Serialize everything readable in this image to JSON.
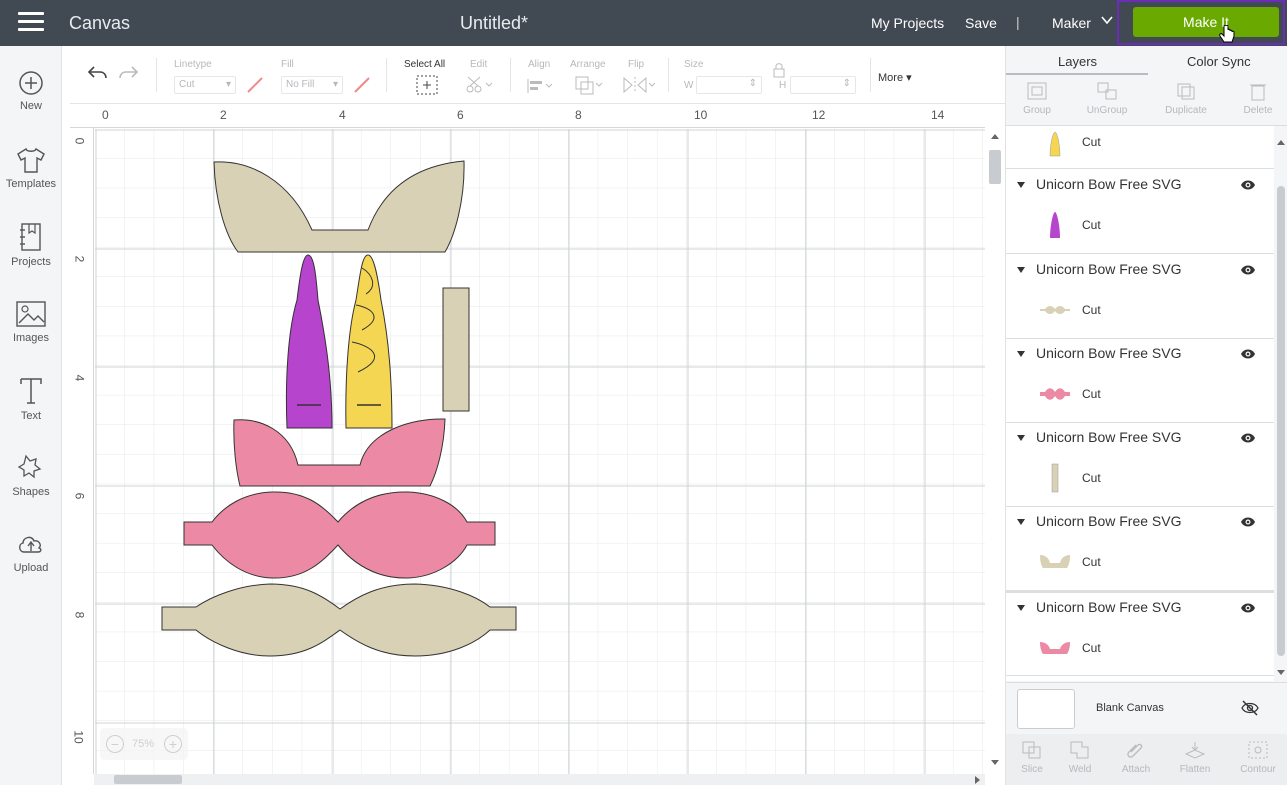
{
  "topbar": {
    "app_title": "Canvas",
    "doc_title": "Untitled*",
    "my_projects": "My Projects",
    "save": "Save",
    "separator": "|",
    "machine": "Maker",
    "make_it": "Make It"
  },
  "leftnav": {
    "items": [
      {
        "label": "New",
        "icon": "plus-circle-icon"
      },
      {
        "label": "Templates",
        "icon": "shirt-icon"
      },
      {
        "label": "Projects",
        "icon": "notebook-icon"
      },
      {
        "label": "Images",
        "icon": "image-icon"
      },
      {
        "label": "Text",
        "icon": "text-icon"
      },
      {
        "label": "Shapes",
        "icon": "shapes-icon"
      },
      {
        "label": "Upload",
        "icon": "cloud-upload-icon"
      }
    ]
  },
  "toolbar": {
    "linetype_label": "Linetype",
    "linetype_value": "Cut",
    "fill_label": "Fill",
    "fill_value": "No Fill",
    "select_all": "Select All",
    "edit": "Edit",
    "align": "Align",
    "arrange": "Arrange",
    "flip": "Flip",
    "size": "Size",
    "w_label": "W",
    "h_label": "H",
    "more": "More"
  },
  "ruler": {
    "top": [
      "0",
      "2",
      "4",
      "6",
      "8",
      "10",
      "12",
      "14"
    ],
    "left": [
      "0",
      "2",
      "4",
      "6",
      "8",
      "10"
    ]
  },
  "zoom": {
    "level": "75%"
  },
  "panel": {
    "tab_layers": "Layers",
    "tab_color_sync": "Color Sync",
    "tools": [
      "Group",
      "UnGroup",
      "Duplicate",
      "Delete"
    ],
    "top_partial_cut": "Cut",
    "layers": [
      {
        "name": "Unicorn Bow Free SVG",
        "cut": "Cut",
        "thumb_color": "#b644cc"
      },
      {
        "name": "Unicorn Bow Free SVG",
        "cut": "Cut",
        "thumb_color": "#d8d1b5"
      },
      {
        "name": "Unicorn Bow Free SVG",
        "cut": "Cut",
        "thumb_color": "#ec8aa6"
      },
      {
        "name": "Unicorn Bow Free SVG",
        "cut": "Cut",
        "thumb_color": "#d8d1b5"
      },
      {
        "name": "Unicorn Bow Free SVG",
        "cut": "Cut",
        "thumb_color": "#d8d1b5"
      },
      {
        "name": "Unicorn Bow Free SVG",
        "cut": "Cut",
        "thumb_color": "#ec8aa6"
      }
    ],
    "blank_canvas": "Blank Canvas",
    "bottom_tools": [
      "Slice",
      "Weld",
      "Attach",
      "Flatten",
      "Contour"
    ]
  },
  "colors": {
    "topbar": "#414a53",
    "make_it": "#6aaa00",
    "tan": "#d8d1b5",
    "purple": "#b644cc",
    "yellow": "#f4d653",
    "pink": "#ec8aa6"
  }
}
